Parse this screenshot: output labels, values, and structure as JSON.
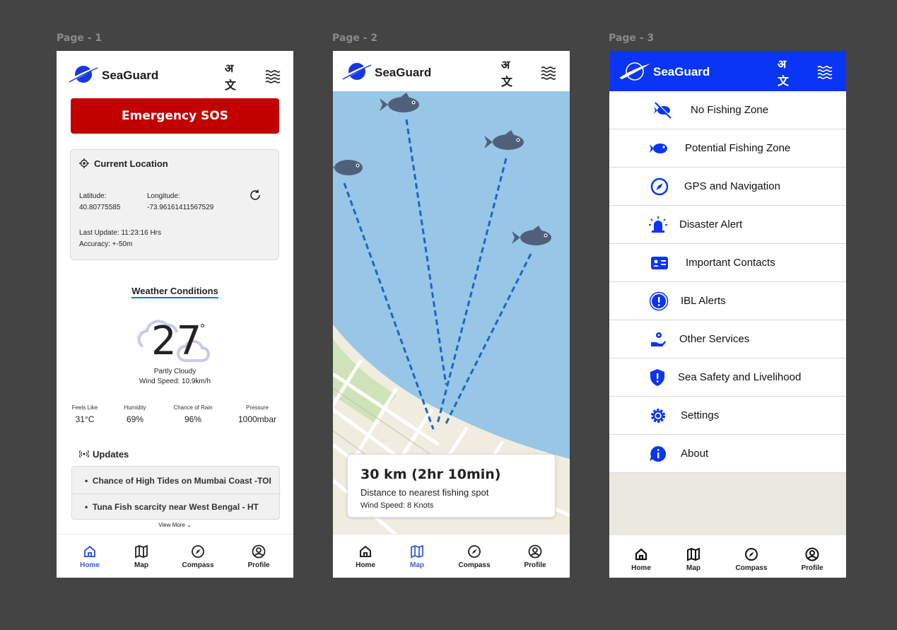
{
  "canvas": {
    "page_labels": [
      "Page - 1",
      "Page - 2",
      "Page - 3"
    ]
  },
  "colors": {
    "brand_blue": "#0a35f5",
    "sos_red": "#c30000",
    "active_nav": "#3b5bdb",
    "sea": "#97c6e6",
    "land": "#f1ece0"
  },
  "brand": {
    "name": "SeaGuard",
    "lang_glyph": "अ文"
  },
  "page1": {
    "sos_label": "Emergency SOS",
    "location": {
      "title": "Current Location",
      "latitude_label": "Latitude:",
      "latitude_value": "40.80775585",
      "longitude_label": "Longitude:",
      "longitude_value": "-73.96161411567529",
      "last_update": "Last Update: 11:23:16 Hrs",
      "accuracy": "Accuracy: +-50m"
    },
    "weather": {
      "title": "Weather Conditions",
      "temperature": "27",
      "degree": "°",
      "condition": "Partly Cloudy",
      "wind": "Wind Speed: 10.9km/h",
      "stats": [
        {
          "label": "Feels Like",
          "value": "31°C"
        },
        {
          "label": "Humidity",
          "value": "69%"
        },
        {
          "label": "Chance of Rain",
          "value": "96%"
        },
        {
          "label": "Pressure",
          "value": "1000mbar"
        }
      ]
    },
    "updates": {
      "title": "Updates",
      "items": [
        "Chance of High Tides on Mumbai Coast -TOI",
        "Tuna Fish scarcity near West Bengal - HT"
      ],
      "view_more": "View More"
    }
  },
  "page2": {
    "distance": "30 km (2hr 10min)",
    "subtitle": "Distance to nearest fishing spot",
    "wind": "Wind Speed: 8 Knots"
  },
  "page3": {
    "menu": [
      {
        "label": "No Fishing Zone",
        "icon": "no-fishing-icon"
      },
      {
        "label": "Potential Fishing Zone",
        "icon": "fish-icon"
      },
      {
        "label": "GPS and Navigation",
        "icon": "compass-icon"
      },
      {
        "label": "Disaster Alert",
        "icon": "siren-icon"
      },
      {
        "label": "Important Contacts",
        "icon": "contact-card-icon"
      },
      {
        "label": "IBL Alerts",
        "icon": "alert-circle-icon"
      },
      {
        "label": "Other Services",
        "icon": "service-hand-icon"
      },
      {
        "label": "Sea Safety and Livelihood",
        "icon": "shield-alert-icon"
      },
      {
        "label": "Settings",
        "icon": "gear-icon"
      },
      {
        "label": "About",
        "icon": "info-bubble-icon"
      }
    ]
  },
  "nav": {
    "items": [
      {
        "label": "Home",
        "icon": "home-icon"
      },
      {
        "label": "Map",
        "icon": "map-icon"
      },
      {
        "label": "Compass",
        "icon": "compass-icon"
      },
      {
        "label": "Profile",
        "icon": "profile-icon"
      }
    ],
    "active_page1": "Home",
    "active_page2": "Map",
    "active_page3": "none"
  }
}
